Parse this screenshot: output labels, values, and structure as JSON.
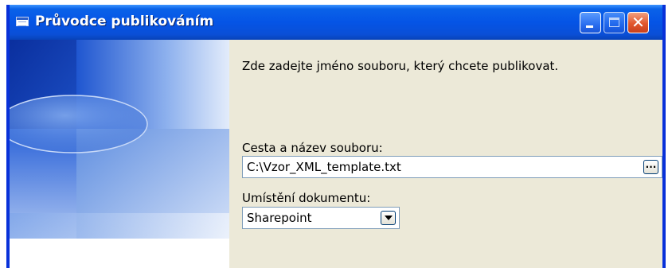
{
  "window": {
    "title": "Průvodce publikováním"
  },
  "titlebar_buttons": {
    "minimize_icon": "minimize-icon",
    "maximize_icon": "maximize-icon",
    "close_icon": "close-icon",
    "close_glyph": "✕"
  },
  "wizard": {
    "instruction": "Zde zadejte jméno souboru, který chcete publikovat.",
    "path_label": "Cesta a název souboru:",
    "path_value": "C:\\Vzor_XML_template.txt",
    "browse_label": "...",
    "location_label": "Umístění dokumentu:",
    "location_value": "Sharepoint"
  },
  "colors": {
    "titlebar": "#0554e6",
    "dialog_background": "#ece9d8",
    "close_button": "#e2572d",
    "input_border": "#7f9db9"
  }
}
